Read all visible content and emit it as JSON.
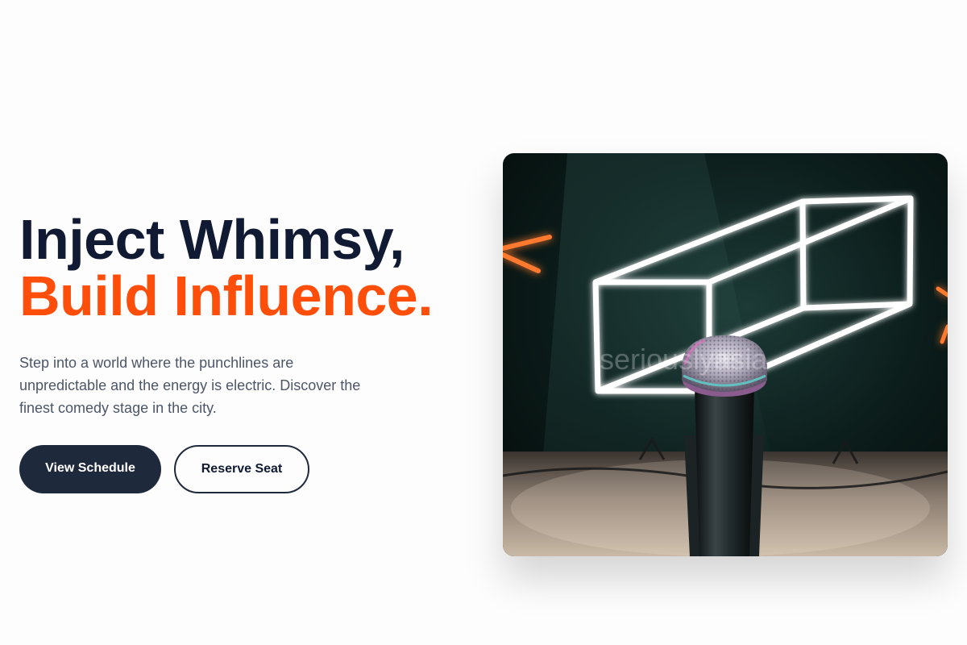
{
  "hero": {
    "headline_line1": "Inject Whimsy,",
    "headline_line2": "Build Influence.",
    "description": "Step into a world where the punchlines are unpredictable and the energy is electric. Discover the finest comedy stage in the city.",
    "primary_cta": "View Schedule",
    "secondary_cta": "Reserve Seat"
  },
  "image": {
    "subject": "microphone-in-front-of-neon-cube",
    "watermark": "seriouslyasia"
  },
  "colors": {
    "headline_dark": "#101a33",
    "headline_accent": "#ff4d0a",
    "body_text": "#4d5668",
    "button_dark": "#1e293b",
    "page_bg": "#fdfdfd"
  }
}
